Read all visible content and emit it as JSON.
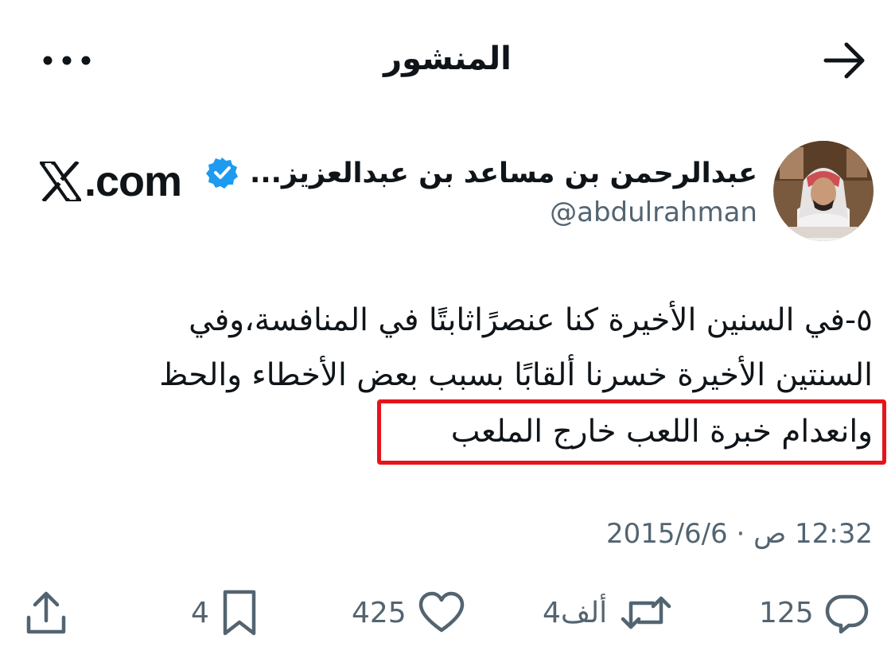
{
  "header": {
    "title": "المنشور"
  },
  "author": {
    "name": "عبدالرحمن بن مساعد بن عبدالعزيز...",
    "handle": "@abdulrahman",
    "verified": true,
    "badge_color": "#1d9bf0"
  },
  "brand": {
    "logo_text": ".com"
  },
  "tweet": {
    "lines": [
      "٥-في السنين الأخيرة كنا عنصرًاثابتًا في المنافسة،وفي",
      "السنتين الأخيرة خسرنا ألقابًا بسبب بعض الأخطاء والحظ",
      "وانعدام خبرة اللعب خارج الملعب"
    ],
    "highlight_color": "#e5141a",
    "timestamp": "12:32 ص · 2015/6/6"
  },
  "actions": {
    "replies": "125",
    "retweets": "4ألف",
    "likes": "425",
    "bookmarks": "4"
  },
  "icons": {
    "back": "arrow-right-icon",
    "more": "more-dots-icon",
    "reply": "reply-bubble-icon",
    "retweet": "retweet-icon",
    "like": "heart-icon",
    "bookmark": "bookmark-icon",
    "share": "share-upload-icon"
  }
}
